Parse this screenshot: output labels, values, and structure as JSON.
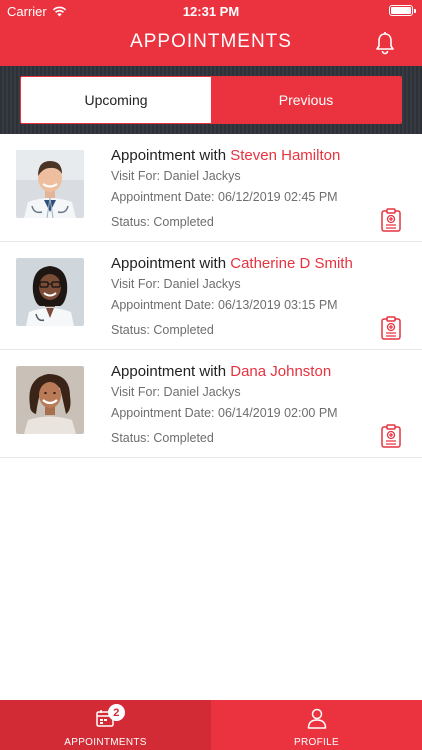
{
  "status_bar": {
    "carrier": "Carrier",
    "time": "12:31 PM"
  },
  "header": {
    "title": "APPOINTMENTS",
    "icon": "bell-icon"
  },
  "segments": {
    "upcoming": "Upcoming",
    "previous": "Previous",
    "selected": "Upcoming"
  },
  "appointments": [
    {
      "prefix": "Appointment with",
      "doctor": "Steven Hamilton",
      "visit_for": "Visit For: Daniel Jackys",
      "date_label": "Appointment Date:",
      "date": "06/12/2019",
      "time": "02:45 PM",
      "status": "Status: Completed"
    },
    {
      "prefix": "Appointment with",
      "doctor": "Catherine D Smith",
      "visit_for": "Visit For: Daniel Jackys",
      "date_label": "Appointment Date:",
      "date": "06/13/2019",
      "time": "03:15 PM",
      "status": "Status: Completed"
    },
    {
      "prefix": "Appointment with",
      "doctor": "Dana Johnston",
      "visit_for": "Visit For: Daniel Jackys",
      "date_label": "Appointment Date:",
      "date": "06/14/2019",
      "time": "02:00 PM",
      "status": "Status: Completed"
    }
  ],
  "tabbar": {
    "appointments_label": "APPOINTMENTS",
    "appointments_badge": "2",
    "profile_label": "PROFILE"
  },
  "colors": {
    "primary": "#eb3340",
    "primary_dark": "#d22b36",
    "band": "#2e3138",
    "doctor_name": "#e63340"
  }
}
